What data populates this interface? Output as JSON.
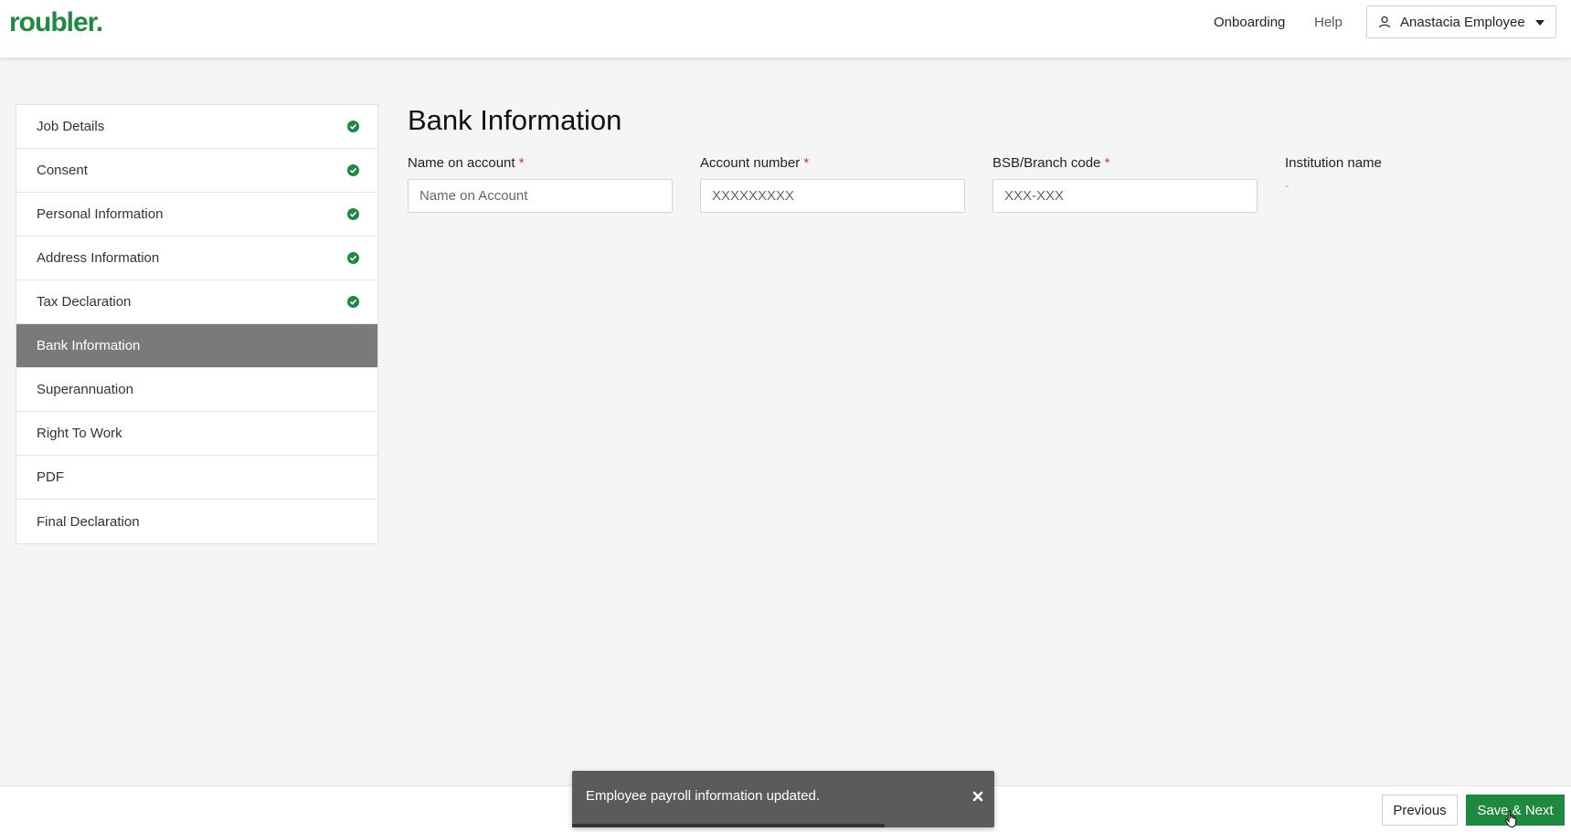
{
  "header": {
    "logo": "roubler.",
    "nav": {
      "onboarding": "Onboarding",
      "help": "Help"
    },
    "user_name": "Anastacia Employee"
  },
  "sidebar": {
    "items": [
      {
        "label": "Job Details",
        "done": true
      },
      {
        "label": "Consent",
        "done": true
      },
      {
        "label": "Personal Information",
        "done": true
      },
      {
        "label": "Address Information",
        "done": true
      },
      {
        "label": "Tax Declaration",
        "done": true
      },
      {
        "label": "Bank Information",
        "active": true
      },
      {
        "label": "Superannuation"
      },
      {
        "label": "Right To Work"
      },
      {
        "label": "PDF"
      },
      {
        "label": "Final Declaration"
      }
    ]
  },
  "main": {
    "title": "Bank Information",
    "fields": {
      "name_on_account": {
        "label": "Name on account",
        "required": "*",
        "placeholder": "Name on Account",
        "value": ""
      },
      "account_number": {
        "label": "Account number",
        "required": "*",
        "placeholder": "XXXXXXXXX",
        "value": ""
      },
      "bsb": {
        "label": "BSB/Branch code",
        "required": "*",
        "placeholder": "XXX-XXX",
        "value": ""
      },
      "institution": {
        "label": "Institution name",
        "value": "-"
      }
    }
  },
  "footer": {
    "previous": "Previous",
    "save_next": "Save & Next"
  },
  "toast": {
    "message": "Employee payroll information updated.",
    "progress": 0.74
  },
  "colors": {
    "brand": "#1f8a3f",
    "active_step": "#7a7a7a",
    "toast_bg": "#5b5b5b",
    "required": "#d9342b"
  },
  "icons": {
    "user": "user-icon",
    "caret": "chevron-down-icon",
    "check": "check-circle-icon",
    "close": "close-icon",
    "cursor": "hand-cursor-icon"
  }
}
